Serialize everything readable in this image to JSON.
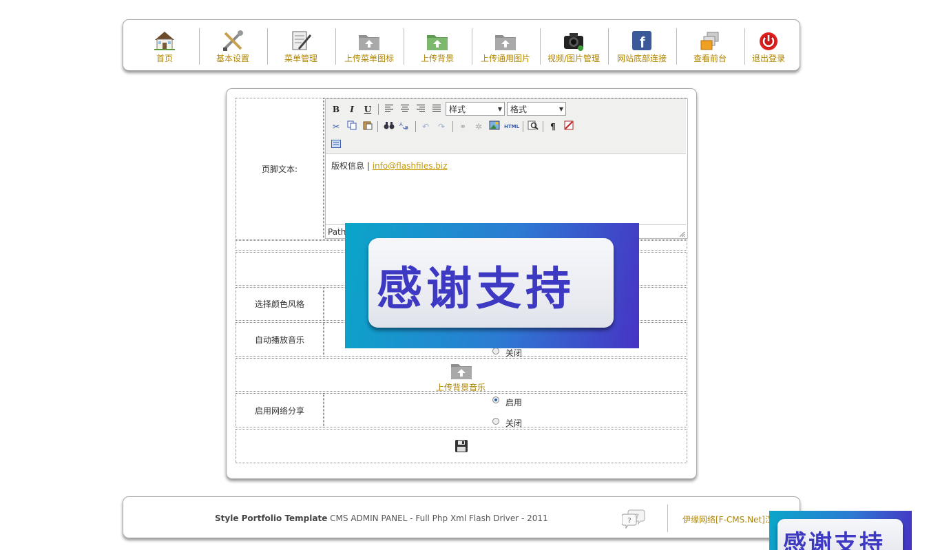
{
  "nav": {
    "items": [
      {
        "label": "首页",
        "icon": "house-icon"
      },
      {
        "label": "基本设置",
        "icon": "tools-icon"
      },
      {
        "label": "菜单管理",
        "icon": "edit-document-icon"
      },
      {
        "label": "上传菜单图标",
        "icon": "upload-folder-icon"
      },
      {
        "label": "上传背景",
        "icon": "upload-folder-green-icon"
      },
      {
        "label": "上传通用图片",
        "icon": "upload-folder-icon"
      },
      {
        "label": "视频/图片管理",
        "icon": "camera-icon"
      },
      {
        "label": "网站底部连接",
        "icon": "facebook-icon"
      },
      {
        "label": "查看前台",
        "icon": "windows-icon"
      },
      {
        "label": "退出登录",
        "icon": "power-icon"
      }
    ]
  },
  "form": {
    "footer_text_label": "页脚文本:",
    "editor": {
      "bold": "B",
      "italic": "I",
      "underline": "U",
      "style_select": "样式",
      "format_select": "格式",
      "html_button": "HTML",
      "pilcrow": "¶",
      "content_text": "版权信息 | ",
      "content_link": "info@flashfiles.biz",
      "path_label": "Path"
    },
    "color_style_label": "选择颜色风格",
    "autoplay_label": "自动播放音乐",
    "autoplay_off": "关闭",
    "upload_music_label": "上传背景音乐",
    "share_label": "启用网络分享",
    "share_on": "启用",
    "share_off": "关闭",
    "share_selected": "启用"
  },
  "overlay": {
    "text": "感谢支持"
  },
  "footer": {
    "brand": "Style Portfolio Template",
    "tagline": " CMS ADMIN PANEL - Full Php Xml Flash Driver - 2011",
    "credit": "伊缘网络[F-CMS.Net]汉"
  },
  "colors": {
    "nav_label": "#b08500",
    "link": "#c89a00",
    "banner_text": "#3e39c2"
  }
}
